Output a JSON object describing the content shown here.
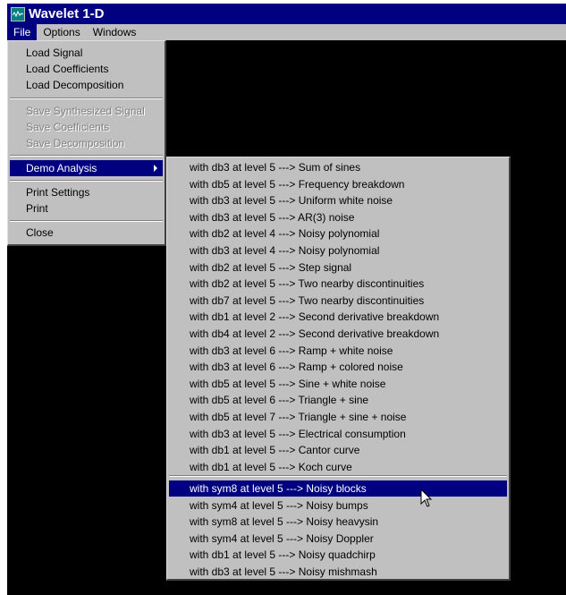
{
  "window": {
    "title": "Wavelet 1-D"
  },
  "menubar": {
    "items": [
      "File",
      "Options",
      "Windows"
    ]
  },
  "file_menu": {
    "load_signal": "Load Signal",
    "load_coefficients": "Load Coefficients",
    "load_decomposition": "Load Decomposition",
    "save_synthesized_signal": "Save Synthesized Signal",
    "save_coefficients": "Save Coefficients",
    "save_decomposition": "Save Decomposition",
    "demo_analysis": "Demo Analysis",
    "print_settings": "Print Settings",
    "print": "Print",
    "close": "Close"
  },
  "demo_menu": {
    "group1": [
      "with db3 at level 5  --->  Sum of sines",
      "with db5 at level 5  --->  Frequency breakdown",
      "with db3 at level 5  --->  Uniform white noise",
      "with db3 at level 5  --->  AR(3) noise",
      "with db2 at level 4  --->  Noisy polynomial",
      "with db3 at level 4  --->  Noisy polynomial",
      "with db2 at level 5  --->  Step signal",
      "with db2 at level 5  --->  Two nearby discontinuities",
      "with db7 at level 5  --->  Two nearby discontinuities",
      "with db1 at level 2  --->  Second derivative breakdown",
      "with db4 at level 2  --->  Second derivative breakdown",
      "with db3 at level 6  --->  Ramp + white noise",
      "with db3 at level 6  --->  Ramp + colored noise",
      "with db5 at level 5  --->  Sine + white noise",
      "with db5 at level 6  --->  Triangle + sine",
      "with db5 at level 7  --->  Triangle + sine + noise",
      "with db3 at level 5  --->  Electrical consumption",
      "with db1 at level 5  --->  Cantor curve",
      "with db1 at level 5  --->  Koch curve"
    ],
    "group2": [
      "with sym8 at level 5  --->  Noisy blocks",
      "with sym4 at level 5  --->  Noisy bumps",
      "with sym8 at level 5  --->  Noisy heavysin",
      "with sym4 at level 5  --->  Noisy Doppler",
      "with db1   at level 5  --->  Noisy quadchirp",
      "with db3   at level 5  --->  Noisy mishmash"
    ]
  }
}
